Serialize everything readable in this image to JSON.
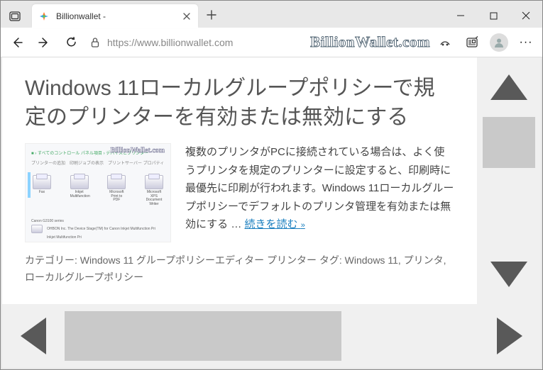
{
  "titlebar": {
    "tab_title": "Billionwallet -"
  },
  "toolbar": {
    "url": "https://www.billionwallet.com",
    "watermark": "BillionWallet.com"
  },
  "article": {
    "title": "Windows 11ローカルグループポリシーで規定のプリンターを有効または無効にする",
    "excerpt": "複数のプリンタがPCに接続されている場合は、よく使うプリンタを規定のプリンターに設定すると、印刷時に最優先に印刷が行われます。Windows 11ローカルグループポリシーでデフォルトのプリンタ管理を有効または無効にする … ",
    "readmore": "続きを読む",
    "readmore_chev": "»"
  },
  "meta": {
    "cat_label": "カテゴリー: ",
    "cats": "Windows 11  グループポリシーエディター  プリンター",
    "tag_label": "  タグ: ",
    "tags": "Windows 11,  プリンタ,  ローカルグループポリシー"
  },
  "thumb": {
    "watermark": "BillionWallet.com",
    "printers": [
      {
        "lbl": "Fax"
      },
      {
        "lbl": "Inkjet Multifunction"
      },
      {
        "lbl": "Microsoft Print to PDF"
      },
      {
        "lbl": "Microsoft XPS Document Writer"
      }
    ],
    "btxt1": "Canon G3100 series",
    "btxt2": "OHBON Inc.   The Device Stage(TM) for Canon Inkjet Multifunction Pri",
    "btxt3": "Inkjet Multifunction Pri"
  }
}
